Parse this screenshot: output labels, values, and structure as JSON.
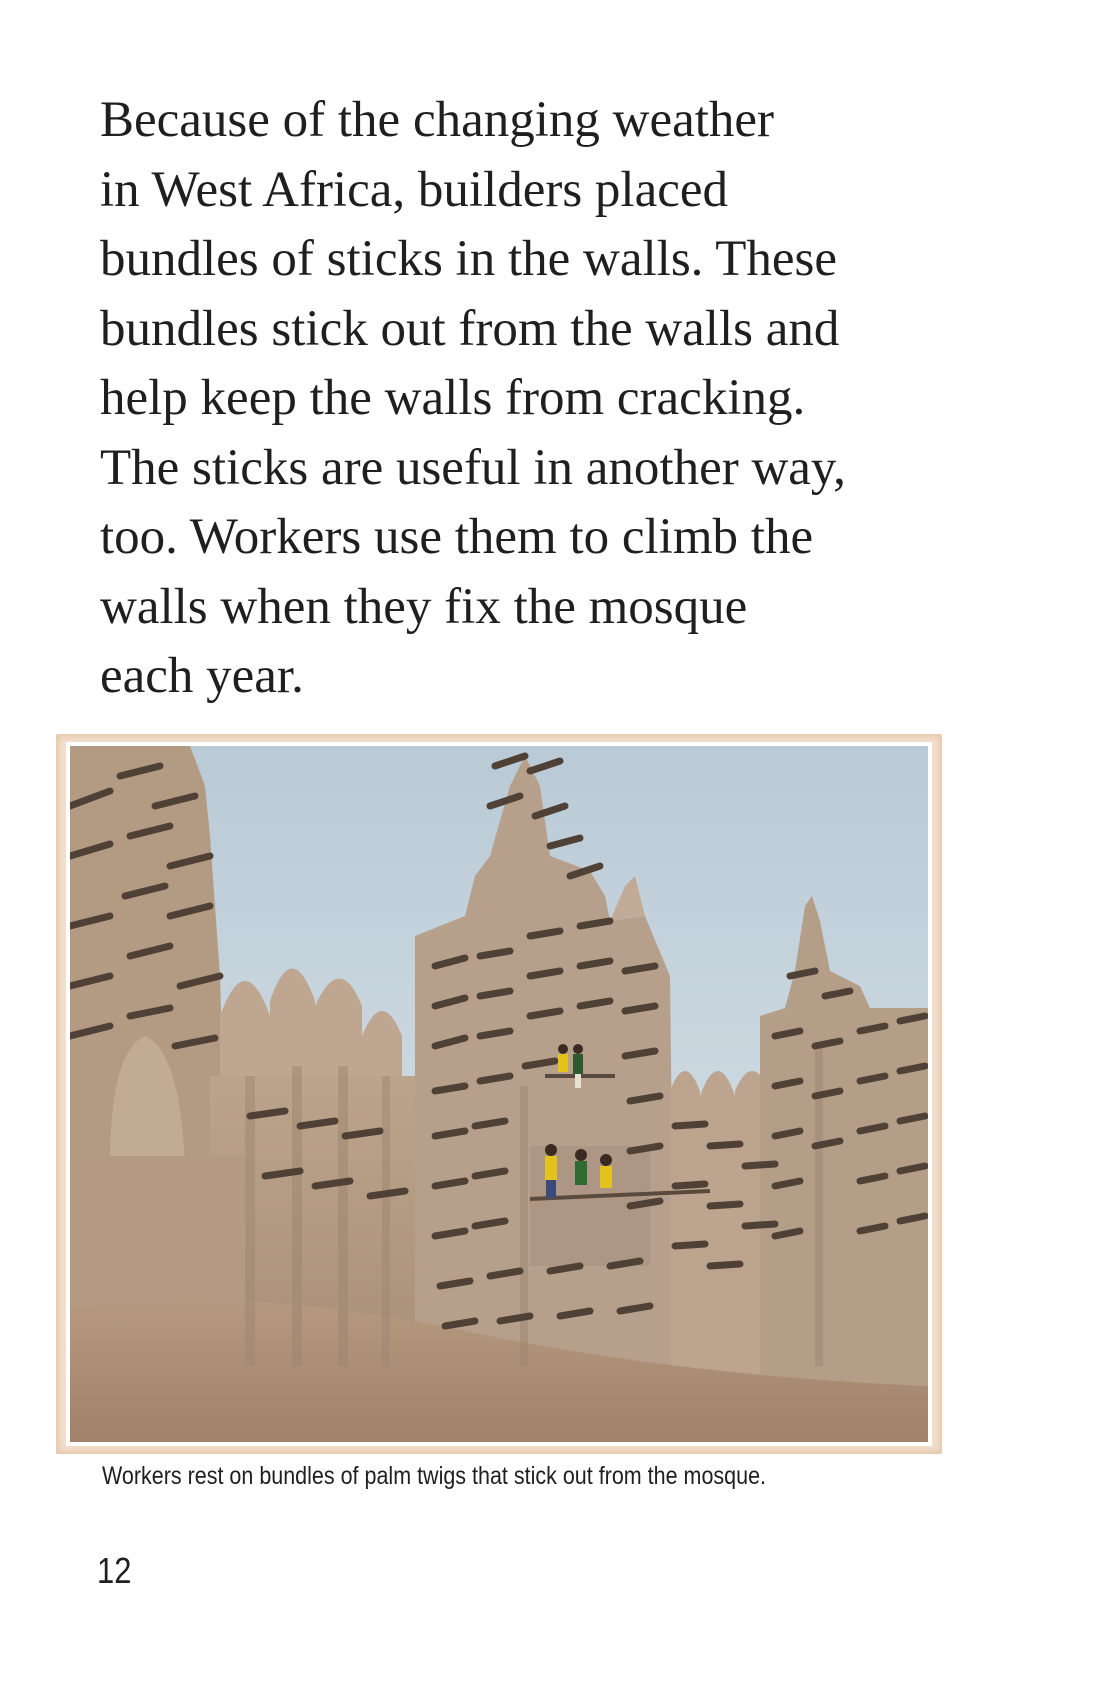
{
  "body_text": {
    "lines": [
      "Because of the changing weather",
      "in West Africa, builders placed",
      "bundles of sticks in the walls. These",
      "bundles stick out from the walls and",
      "help keep the walls from cracking.",
      "The sticks are useful in another way,",
      "too. Workers use them to climb the",
      "walls when they fix the mosque",
      "each year."
    ]
  },
  "photo": {
    "subject": "mud-brick mosque with protruding palm-twig bundles and workers on the wall",
    "colors": {
      "sky": "#c9d6de",
      "wall": "#b89e86",
      "wall_shadow": "#9c8470",
      "sticks": "#5a4a3e",
      "frame": "#f2dfcc"
    }
  },
  "caption": "Workers rest on bundles of palm twigs that stick out from the mosque.",
  "page_number": "12"
}
